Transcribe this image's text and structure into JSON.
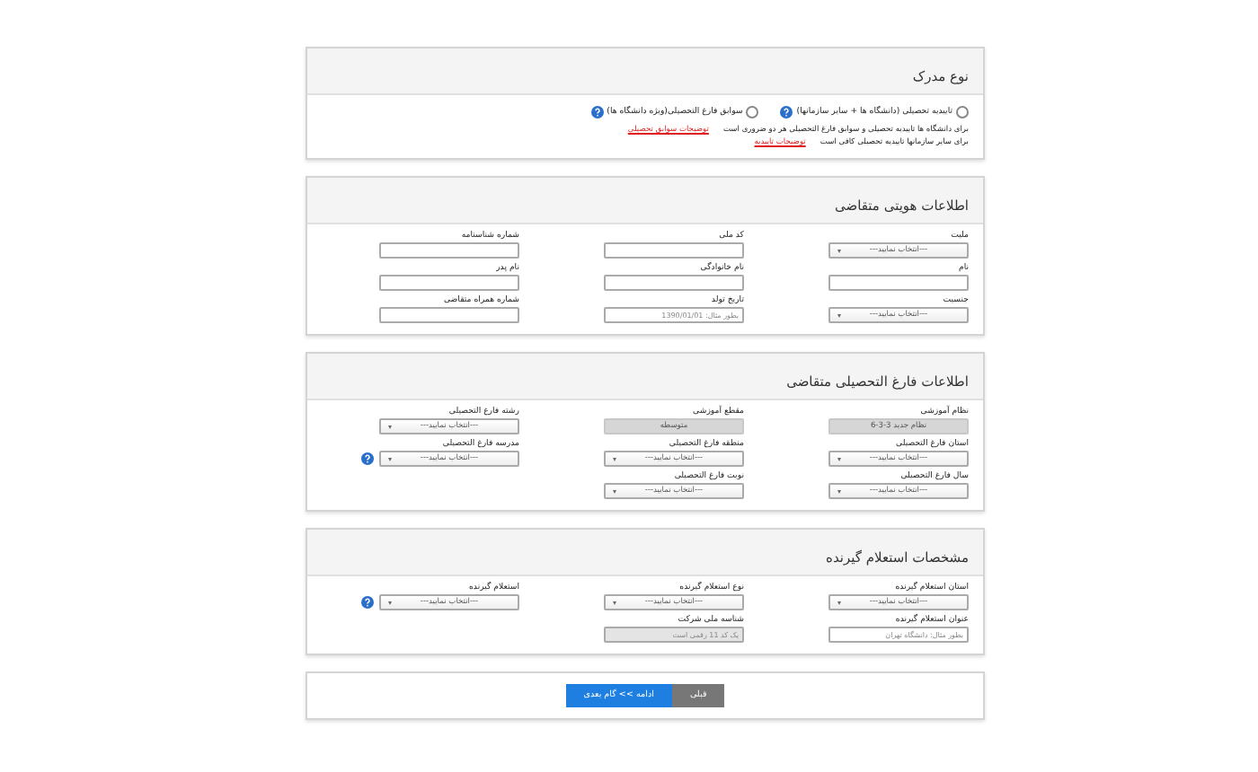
{
  "document_type": {
    "title": "نوع مدرک",
    "options": [
      {
        "label": "تاییدیه تحصیلی (دانشگاه ها + سایر سازمانها)",
        "selected": false,
        "help": true
      },
      {
        "label": "سوابق فارغ التحصیلی(ویژه دانشگاه ها)",
        "selected": false,
        "help": true
      }
    ],
    "notes": [
      {
        "text": "برای دانشگاه ها تاییدیه تحصیلی و سوابق فارغ التحصیلی هر دو ضروری است",
        "link": "توضیحات سوابق تحصیلی"
      },
      {
        "text": "برای سایر سازمانها تاییدیه تحصیلی کافی است",
        "link": "توضیحات تاییدیه"
      }
    ]
  },
  "sections": [
    {
      "title": "اطلاعات هویتی متقاضی",
      "rows": [
        [
          {
            "label": "ملیت",
            "kind": "select",
            "value": "---انتخاب نمایید---"
          },
          {
            "label": "کد ملی",
            "kind": "input"
          },
          {
            "label": "شماره شناسنامه",
            "kind": "input"
          }
        ],
        [
          {
            "label": "نام",
            "kind": "input"
          },
          {
            "label": "نام خانوادگی",
            "kind": "input"
          },
          {
            "label": "نام پدر",
            "kind": "input"
          }
        ],
        [
          {
            "label": "جنسیت",
            "kind": "select",
            "value": "---انتخاب نمایید---"
          },
          {
            "label": "تاریخ تولد",
            "kind": "input",
            "placeholder": "بطور مثال: 1390/01/01"
          },
          {
            "label": "شماره همراه متقاضی",
            "kind": "input"
          }
        ]
      ]
    },
    {
      "title": "اطلاعات فارغ التحصیلی متقاضی",
      "rows": [
        [
          {
            "label": "نظام آموزشی",
            "kind": "select",
            "disabled": true,
            "value": "نظام جدید 3-3-6"
          },
          {
            "label": "مقطع آموزشی",
            "kind": "select",
            "disabled": true,
            "value": "متوسطه"
          },
          {
            "label": "رشته فارغ التحصیلی",
            "kind": "select",
            "value": "---انتخاب نمایید---"
          }
        ],
        [
          {
            "label": "استان فارغ التحصیلی",
            "kind": "select",
            "value": "---انتخاب نمایید---"
          },
          {
            "label": "منطقه فارغ التحصیلی",
            "kind": "select",
            "value": "---انتخاب نمایید---"
          },
          {
            "label": "مدرسه فارغ التحصیلی",
            "kind": "select",
            "value": "---انتخاب نمایید---",
            "help": true
          }
        ],
        [
          {
            "label": "سال فارغ التحصیلی",
            "kind": "select",
            "value": "---انتخاب نمایید---"
          },
          {
            "label": "نوبت فارغ التحصیلی",
            "kind": "select",
            "value": "---انتخاب نمایید---"
          }
        ]
      ]
    },
    {
      "title": "مشخصات استعلام گیرنده",
      "rows": [
        [
          {
            "label": "استان استعلام گیرنده",
            "kind": "select",
            "value": "---انتخاب نمایید---"
          },
          {
            "label": "نوع استعلام گیرنده",
            "kind": "select",
            "value": "---انتخاب نمایید---"
          },
          {
            "label": "استعلام گیرنده",
            "kind": "select",
            "value": "---انتخاب نمایید---",
            "help": true
          }
        ],
        [
          {
            "label": "عنوان استعلام گیرنده",
            "kind": "input",
            "placeholder": "بطور مثال: دانشگاه تهران"
          },
          {
            "label": "شناسه ملی شرکت",
            "kind": "input",
            "disabled": true,
            "placeholder": "یک کد 11 رقمی است"
          }
        ]
      ]
    }
  ],
  "buttons": [
    {
      "label": "قبلی",
      "kind": "secondary"
    },
    {
      "label": "ادامه >> گام بعدی",
      "kind": "primary"
    }
  ]
}
